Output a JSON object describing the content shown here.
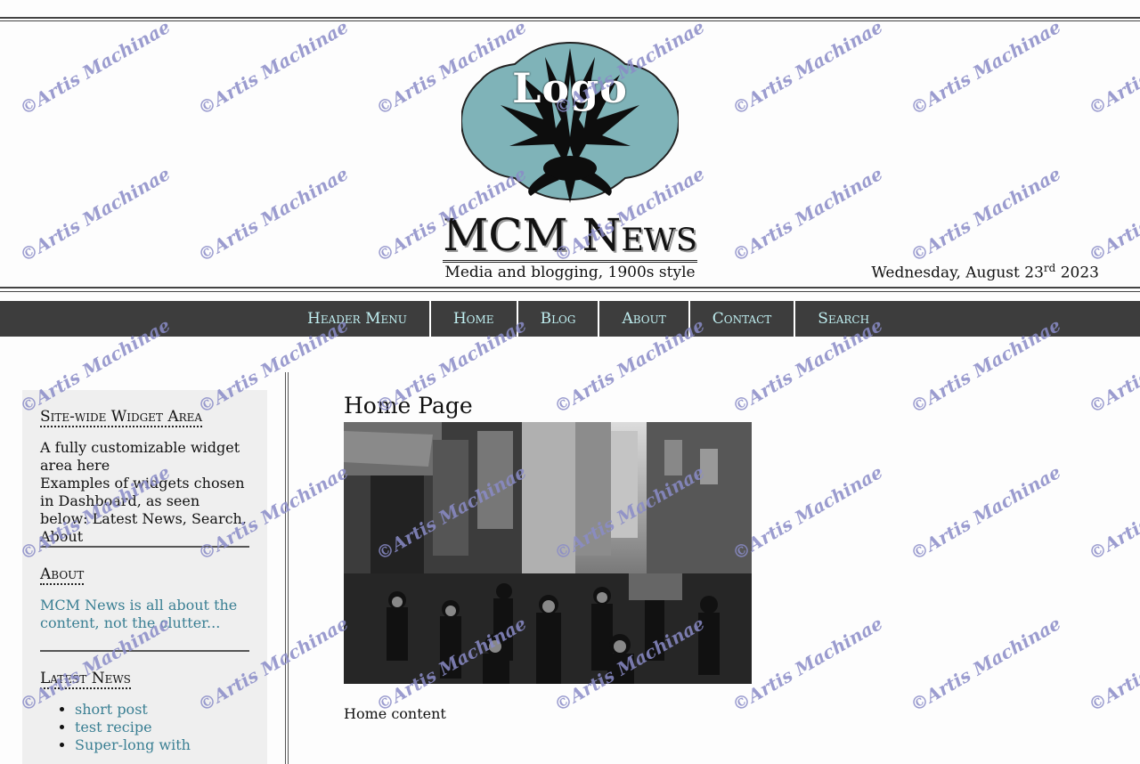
{
  "header": {
    "logo_text": "Logo",
    "site_title": "MCM News",
    "tagline": "Media and blogging, 1900s style",
    "date_text": "Wednesday, August 23",
    "date_suffix": "rd",
    "date_year": " 2023"
  },
  "nav": {
    "items": [
      {
        "label": "Header Menu"
      },
      {
        "label": "Home"
      },
      {
        "label": "Blog"
      },
      {
        "label": "About"
      },
      {
        "label": "Contact"
      },
      {
        "label": "Search"
      }
    ]
  },
  "sidebar": {
    "widget1": {
      "title": "Site-wide Widget Area",
      "line1": "A fully customizable widget area here",
      "line2": "Examples of widgets chosen in Dashboard, as seen below: Latest News, Search, About"
    },
    "about": {
      "title": "About",
      "link": "MCM News is all about the content, not the clutter..."
    },
    "latest": {
      "title": "Latest News",
      "items": [
        {
          "label": "short post"
        },
        {
          "label": "test recipe"
        },
        {
          "label": "Super-long with"
        }
      ]
    }
  },
  "main": {
    "page_title": "Home Page",
    "content": "Home content"
  },
  "watermark": {
    "text": "©Artis Machinae"
  },
  "colors": {
    "nav_bg": "#3d3d3d",
    "nav_text": "#bfeef0",
    "link": "#3a7f93",
    "logo_fill": "#7fb3b8",
    "sidebar_bg": "#efefef"
  }
}
